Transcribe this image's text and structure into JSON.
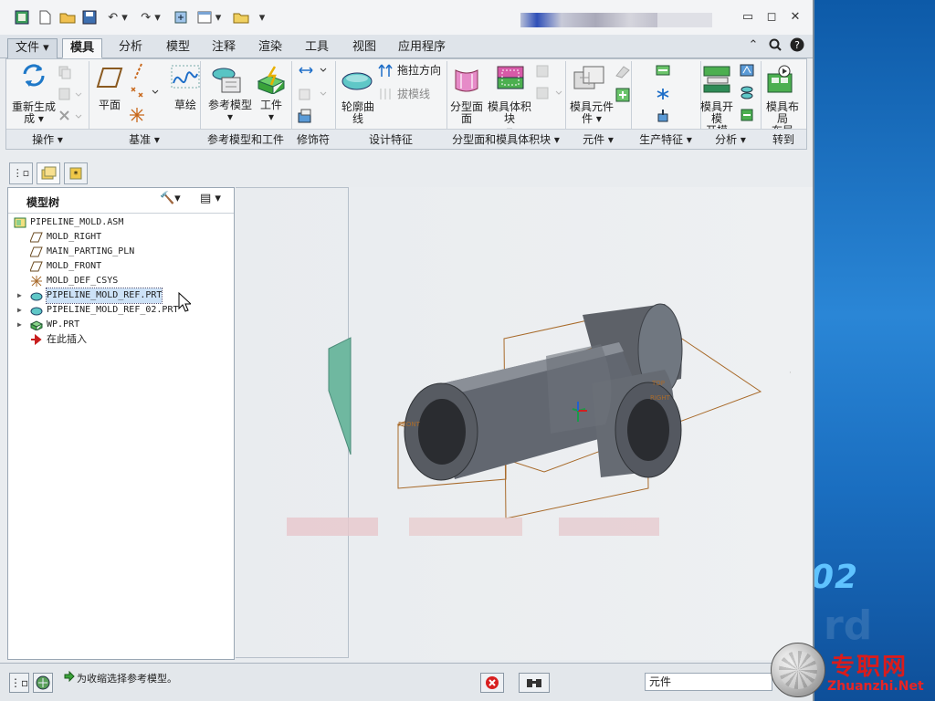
{
  "colors": {
    "accent_blue": "#1f6fb6",
    "selection": "#cde2f7",
    "part_gray": "#5d6168",
    "datum_orange": "#a86a2a"
  },
  "tabs": [
    "文件",
    "模具",
    "分析",
    "模型",
    "注释",
    "渲染",
    "工具",
    "视图",
    "应用程序"
  ],
  "ribbon": {
    "buttons": {
      "regenerate": "重新生成",
      "plane": "平面",
      "sketch": "草绘",
      "ref_model": "参考模型",
      "workpiece": "工件",
      "contour_curve": "轮廓曲线",
      "drag_direction": "拖拉方向",
      "draft_line": "拔模线",
      "parting_surface": "分型面",
      "mold_volume": "模具体积块",
      "mold_component": "模具元件",
      "mold_opening": "模具开模",
      "mold_layout": "模具布局"
    },
    "groups": [
      "操作",
      "基准",
      "参考模型和工件",
      "修饰符",
      "设计特征",
      "分型面和模具体积块",
      "元件",
      "生产特征",
      "分析",
      "转到"
    ]
  },
  "model_tree": {
    "title": "模型树",
    "items": [
      {
        "label": "PIPELINE_MOLD.ASM",
        "icon": "assembly-icon"
      },
      {
        "label": "MOLD_RIGHT",
        "icon": "datum-plane-icon"
      },
      {
        "label": "MAIN_PARTING_PLN",
        "icon": "datum-plane-icon"
      },
      {
        "label": "MOLD_FRONT",
        "icon": "datum-plane-icon"
      },
      {
        "label": "MOLD_DEF_CSYS",
        "icon": "csys-icon"
      },
      {
        "label": "PIPELINE_MOLD_REF.PRT",
        "icon": "ref-part-icon"
      },
      {
        "label": "PIPELINE_MOLD_REF_02.PRT",
        "icon": "ref-part-icon"
      },
      {
        "label": "WP.PRT",
        "icon": "workpiece-icon"
      },
      {
        "label": "在此插入",
        "icon": "insert-here-arrow-icon"
      }
    ]
  },
  "viewport": {
    "datum_labels": [
      "TOP",
      "RIGHT",
      "FRONT"
    ]
  },
  "status": {
    "message": "为收缩选择参考模型。",
    "filter_value": "元件"
  },
  "watermark": {
    "site_cn": "专职网",
    "site_url": "Zhuanzhi.Net",
    "number": "02"
  }
}
